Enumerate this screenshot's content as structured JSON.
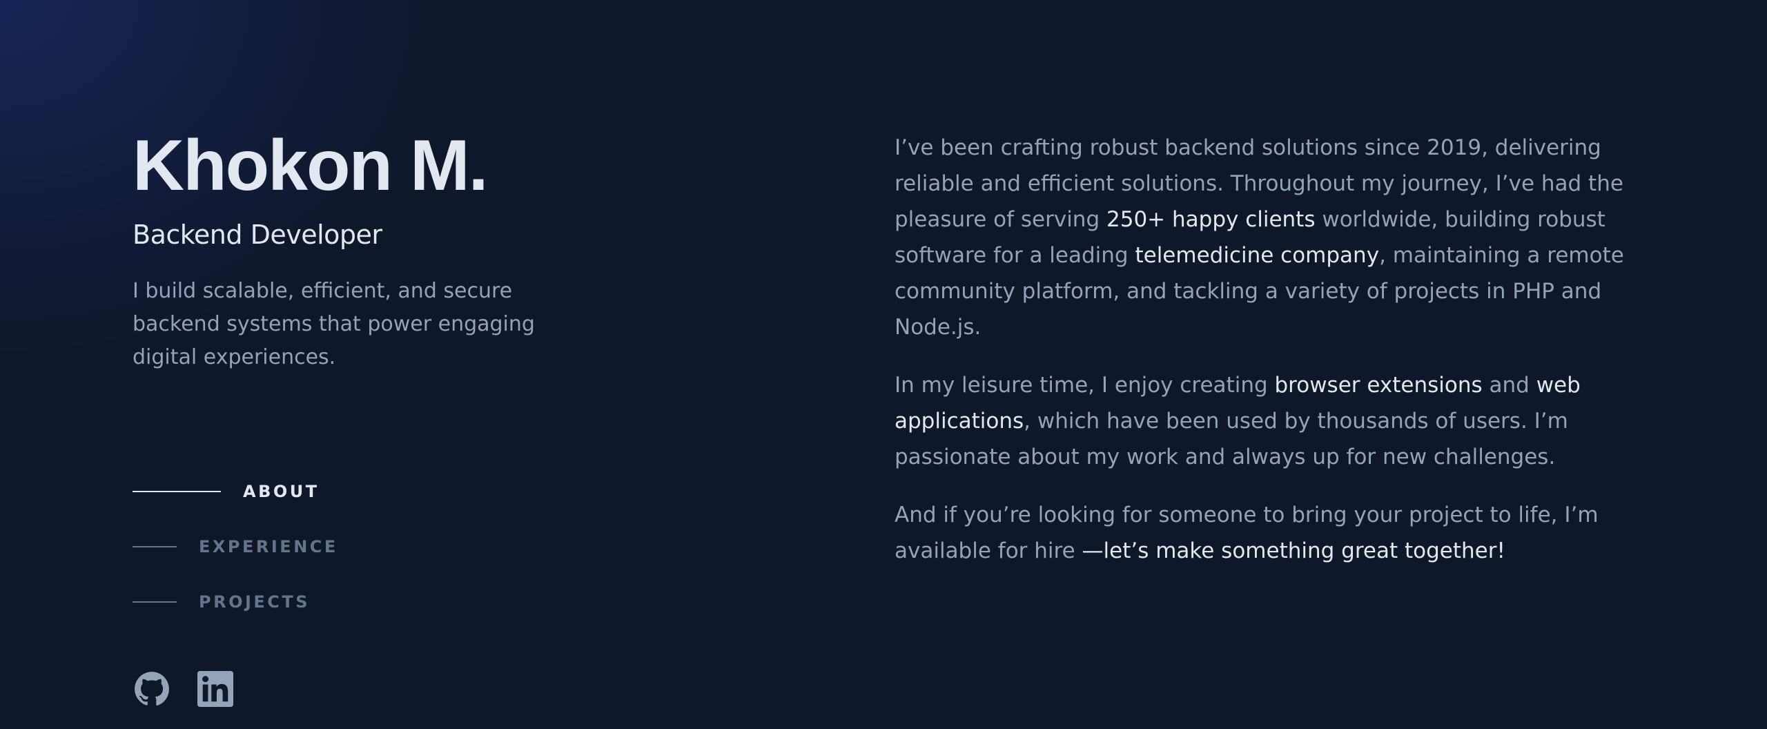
{
  "header": {
    "name": "Khokon M.",
    "role": "Backend Developer",
    "tagline": "I build scalable, efficient, and secure backend systems that power engaging digital experiences."
  },
  "nav": {
    "items": [
      {
        "label": "ABOUT",
        "active": true
      },
      {
        "label": "EXPERIENCE",
        "active": false
      },
      {
        "label": "PROJECTS",
        "active": false
      }
    ]
  },
  "socials": {
    "items": [
      {
        "icon": "github-icon"
      },
      {
        "icon": "linkedin-icon"
      }
    ]
  },
  "about": {
    "p1": {
      "t1": "I’ve been crafting robust backend solutions since 2019, delivering reliable and efficient solutions. Throughout my journey, I’ve had the pleasure of serving ",
      "h1": "250+ happy clients",
      "t2": " worldwide, building robust software for a leading ",
      "h2": "telemedicine company",
      "t3": ", maintaining a remote community platform, and tackling a variety of projects in PHP and Node.js."
    },
    "p2": {
      "t1": "In my leisure time, I enjoy creating ",
      "h1": "browser extensions",
      "t2": " and ",
      "h2": "web applications",
      "t3": ", which have been used by thousands of users. I’m passionate about my work and always up for new challenges."
    },
    "p3": {
      "t1": "And if you’re looking for someone to bring your project to life, I’m available for hire ",
      "h1": "—let’s make something great together!"
    }
  },
  "colors": {
    "background": "#0f172a",
    "heading": "#e2e8f0",
    "muted": "#94a3b8",
    "nav_inactive": "#64748b"
  }
}
